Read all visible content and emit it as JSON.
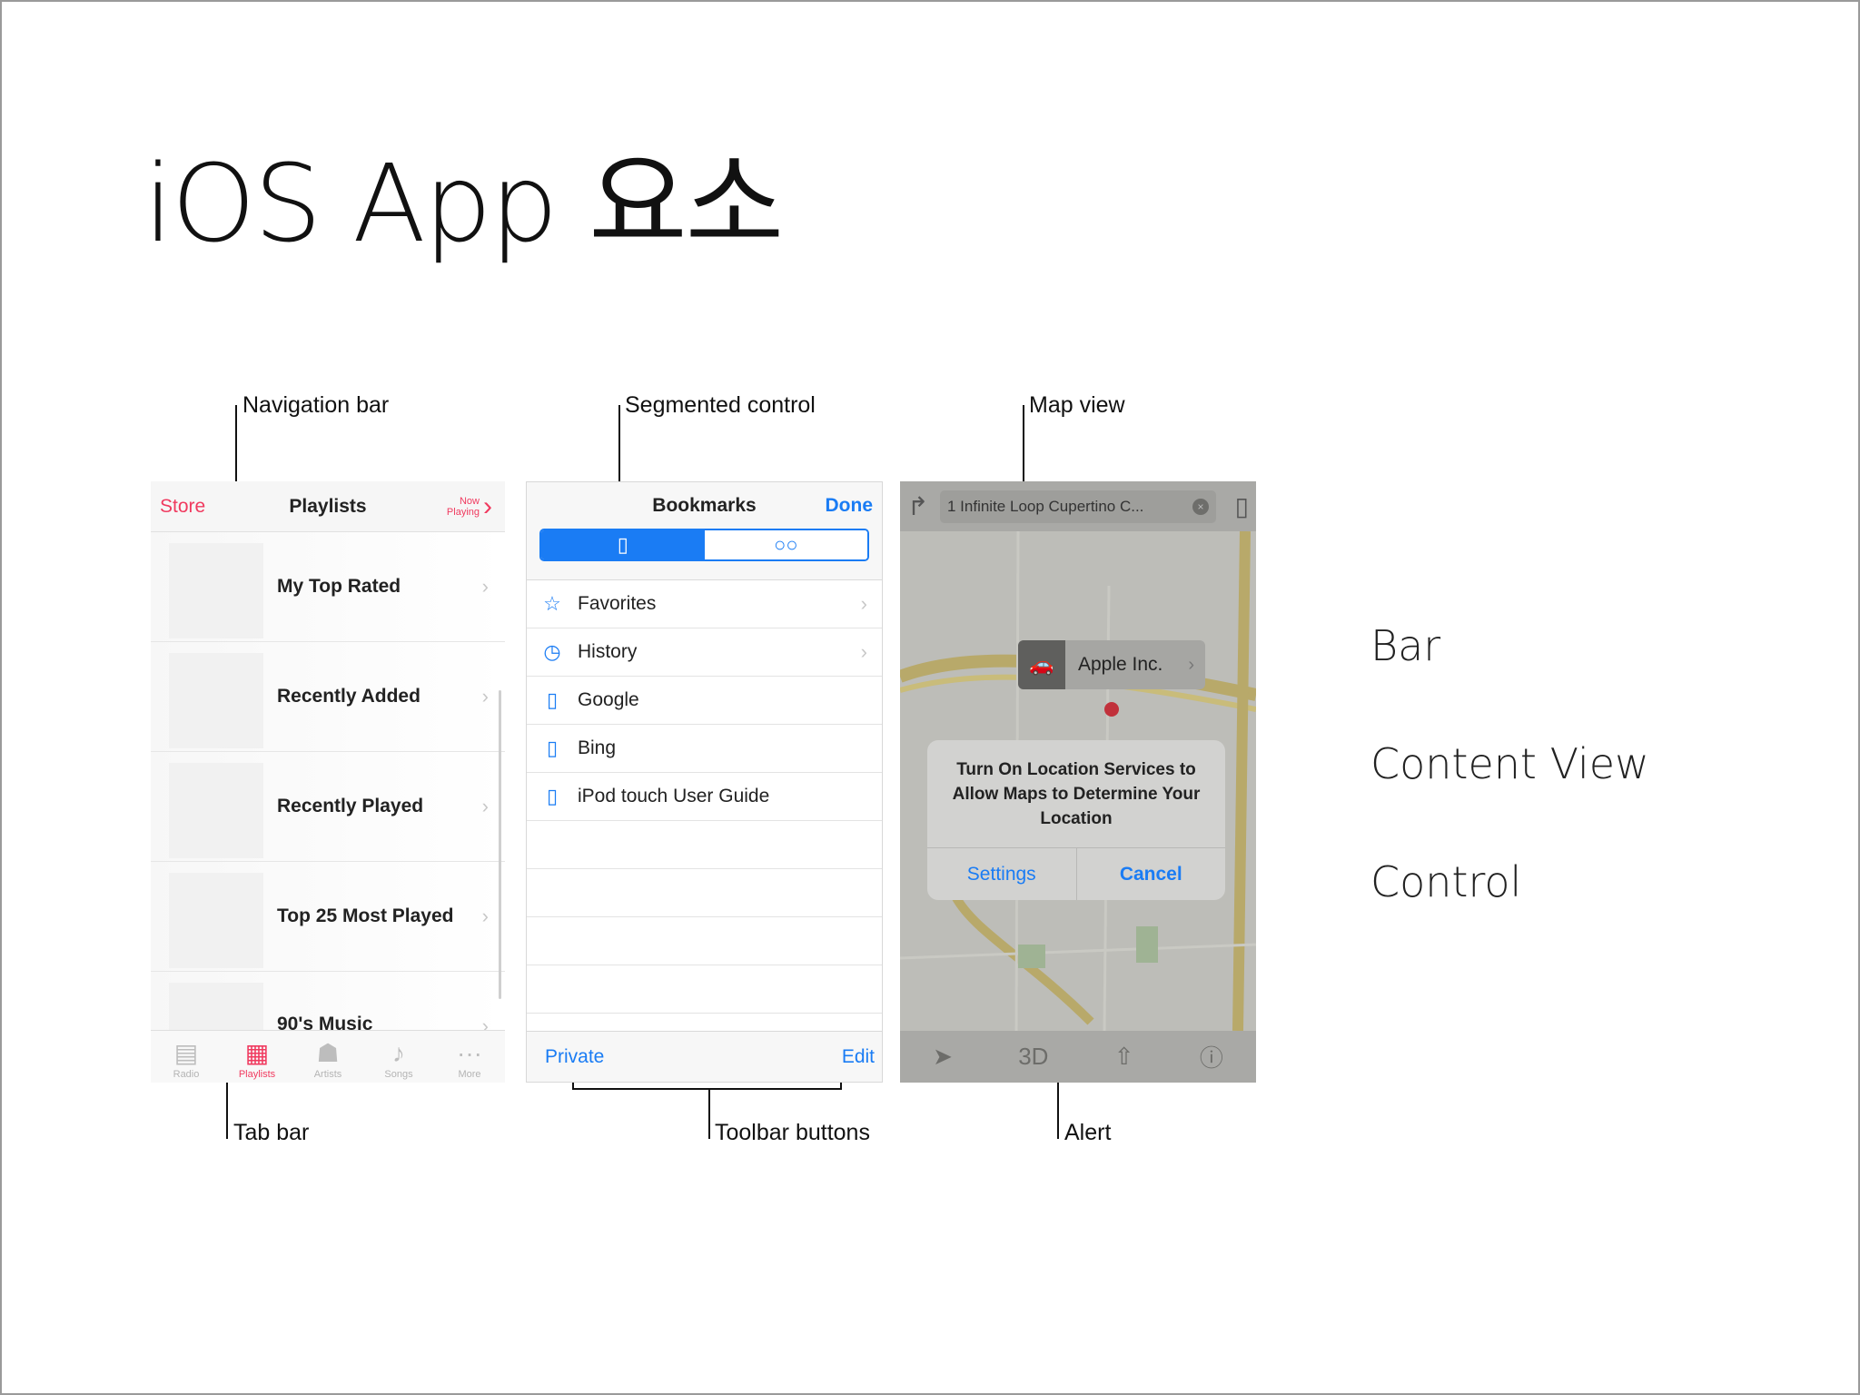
{
  "slide": {
    "title": "iOS App 요소"
  },
  "callouts": {
    "navigation_bar": "Navigation bar",
    "segmented_control": "Segmented control",
    "map_view": "Map view",
    "tab_bar": "Tab bar",
    "toolbar_buttons": "Toolbar buttons",
    "alert": "Alert"
  },
  "right_labels": [
    "Bar",
    "Content View",
    "Control"
  ],
  "music_app": {
    "nav": {
      "left": "Store",
      "title": "Playlists",
      "right_line1": "Now",
      "right_line2": "Playing"
    },
    "rows": [
      "My Top Rated",
      "Recently Added",
      "Recently Played",
      "Top 25 Most Played",
      "90's Music"
    ],
    "tabs": [
      {
        "label": "Radio",
        "icon": "radio-icon"
      },
      {
        "label": "Playlists",
        "icon": "playlists-icon"
      },
      {
        "label": "Artists",
        "icon": "artists-icon"
      },
      {
        "label": "Songs",
        "icon": "songs-icon"
      },
      {
        "label": "More",
        "icon": "more-icon"
      }
    ]
  },
  "safari_app": {
    "nav": {
      "title": "Bookmarks",
      "done": "Done"
    },
    "items": [
      {
        "label": "Favorites",
        "icon": "star-icon"
      },
      {
        "label": "History",
        "icon": "clock-icon"
      },
      {
        "label": "Google",
        "icon": "book-icon"
      },
      {
        "label": "Bing",
        "icon": "book-icon"
      },
      {
        "label": "iPod touch User Guide",
        "icon": "book-icon"
      }
    ],
    "toolbar": {
      "left": "Private",
      "right": "Edit"
    }
  },
  "maps_app": {
    "search_text": "1 Infinite Loop Cupertino C...",
    "callout_name": "Apple Inc.",
    "alert": {
      "message": "Turn On Location Services to\nAllow Maps to Determine Your\nLocation",
      "settings": "Settings",
      "cancel": "Cancel"
    },
    "bottom_3d": "3D"
  },
  "colors": {
    "music_accent": "#f03a5f",
    "ios_blue": "#1a7cf4"
  }
}
